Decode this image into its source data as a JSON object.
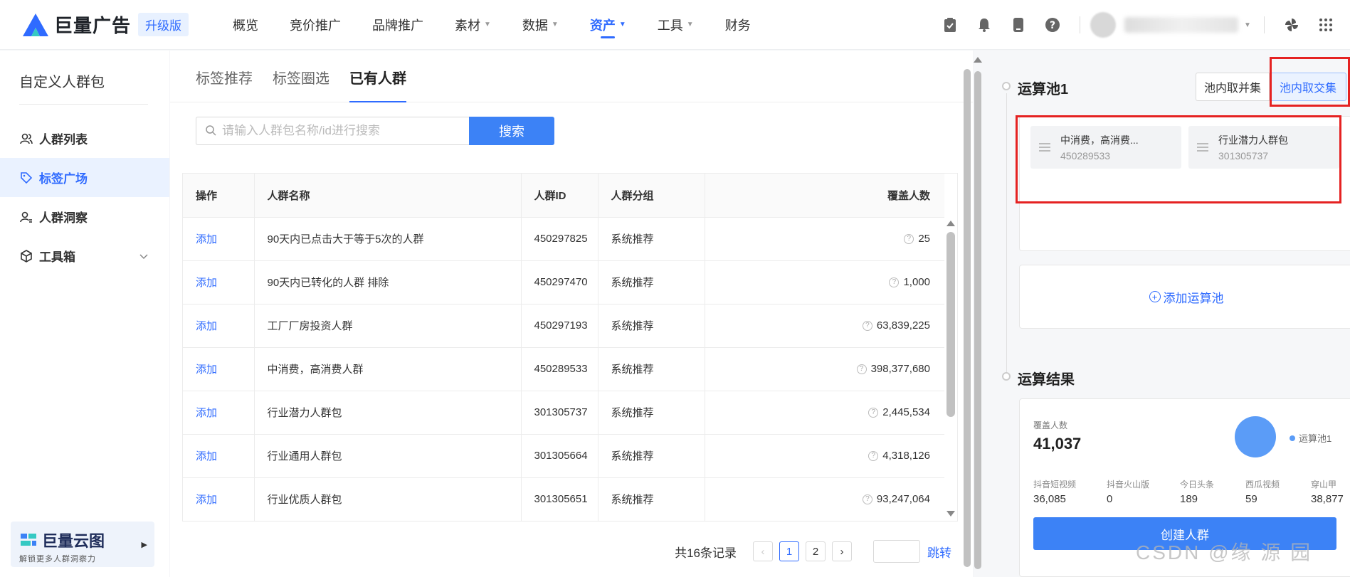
{
  "header": {
    "brand": "巨量广告",
    "badge": "升级版",
    "nav": [
      {
        "label": "概览",
        "caret": false
      },
      {
        "label": "竞价推广",
        "caret": false
      },
      {
        "label": "品牌推广",
        "caret": false
      },
      {
        "label": "素材",
        "caret": true
      },
      {
        "label": "数据",
        "caret": true
      },
      {
        "label": "资产",
        "caret": true,
        "active": true
      },
      {
        "label": "工具",
        "caret": true
      },
      {
        "label": "财务",
        "caret": false
      }
    ]
  },
  "sidebar": {
    "title": "自定义人群包",
    "items": [
      {
        "label": "人群列表",
        "icon": "users-icon"
      },
      {
        "label": "标签广场",
        "icon": "tag-icon",
        "active": true
      },
      {
        "label": "人群洞察",
        "icon": "user-insight-icon"
      },
      {
        "label": "工具箱",
        "icon": "toolbox-icon",
        "expandable": true
      }
    ],
    "promo": {
      "title": "巨量云图",
      "subtitle": "解锁更多人群洞察力"
    }
  },
  "main": {
    "tabs": [
      {
        "label": "标签推荐"
      },
      {
        "label": "标签圈选"
      },
      {
        "label": "已有人群",
        "active": true
      }
    ],
    "search": {
      "placeholder": "请输入人群包名称/id进行搜索",
      "button": "搜索"
    },
    "table": {
      "columns": [
        "操作",
        "人群名称",
        "人群ID",
        "人群分组",
        "覆盖人数"
      ],
      "rows": [
        {
          "action": "添加",
          "name": "90天内已点击大于等于5次的人群",
          "id": "450297825",
          "group": "系统推荐",
          "coverage": "25"
        },
        {
          "action": "添加",
          "name": "90天内已转化的人群 排除",
          "id": "450297470",
          "group": "系统推荐",
          "coverage": "1,000"
        },
        {
          "action": "添加",
          "name": "工厂厂房投资人群",
          "id": "450297193",
          "group": "系统推荐",
          "coverage": "63,839,225"
        },
        {
          "action": "添加",
          "name": "中消费，高消费人群",
          "id": "450289533",
          "group": "系统推荐",
          "coverage": "398,377,680"
        },
        {
          "action": "添加",
          "name": "行业潜力人群包",
          "id": "301305737",
          "group": "系统推荐",
          "coverage": "2,445,534"
        },
        {
          "action": "添加",
          "name": "行业通用人群包",
          "id": "301305664",
          "group": "系统推荐",
          "coverage": "4,318,126"
        },
        {
          "action": "添加",
          "name": "行业优质人群包",
          "id": "301305651",
          "group": "系统推荐",
          "coverage": "93,247,064"
        }
      ]
    },
    "pagination": {
      "total_text": "共16条记录",
      "pages": [
        "1",
        "2"
      ],
      "current": "1",
      "jump_label": "跳转"
    }
  },
  "right_panel": {
    "pool_title": "运算池1",
    "union_label": "池内取并集",
    "intersect_label": "池内取交集",
    "chips": [
      {
        "name": "中消费，高消费...",
        "id": "450289533"
      },
      {
        "name": "行业潜力人群包",
        "id": "301305737"
      }
    ],
    "add_pool_label": "添加运算池",
    "result_title": "运算结果",
    "coverage_label": "覆盖人数",
    "coverage_value": "41,037",
    "legend_label": "运算池1",
    "platforms": [
      {
        "name": "抖音短视频",
        "value": "36,085"
      },
      {
        "name": "抖音火山版",
        "value": "0"
      },
      {
        "name": "今日头条",
        "value": "189"
      },
      {
        "name": "西瓜视频",
        "value": "59"
      },
      {
        "name": "穿山甲",
        "value": "38,877"
      }
    ],
    "create_label": "创建人群",
    "watermark": "CSDN @缘 源 园",
    "accent": "#2f6bff",
    "highlight": "#e52222"
  }
}
